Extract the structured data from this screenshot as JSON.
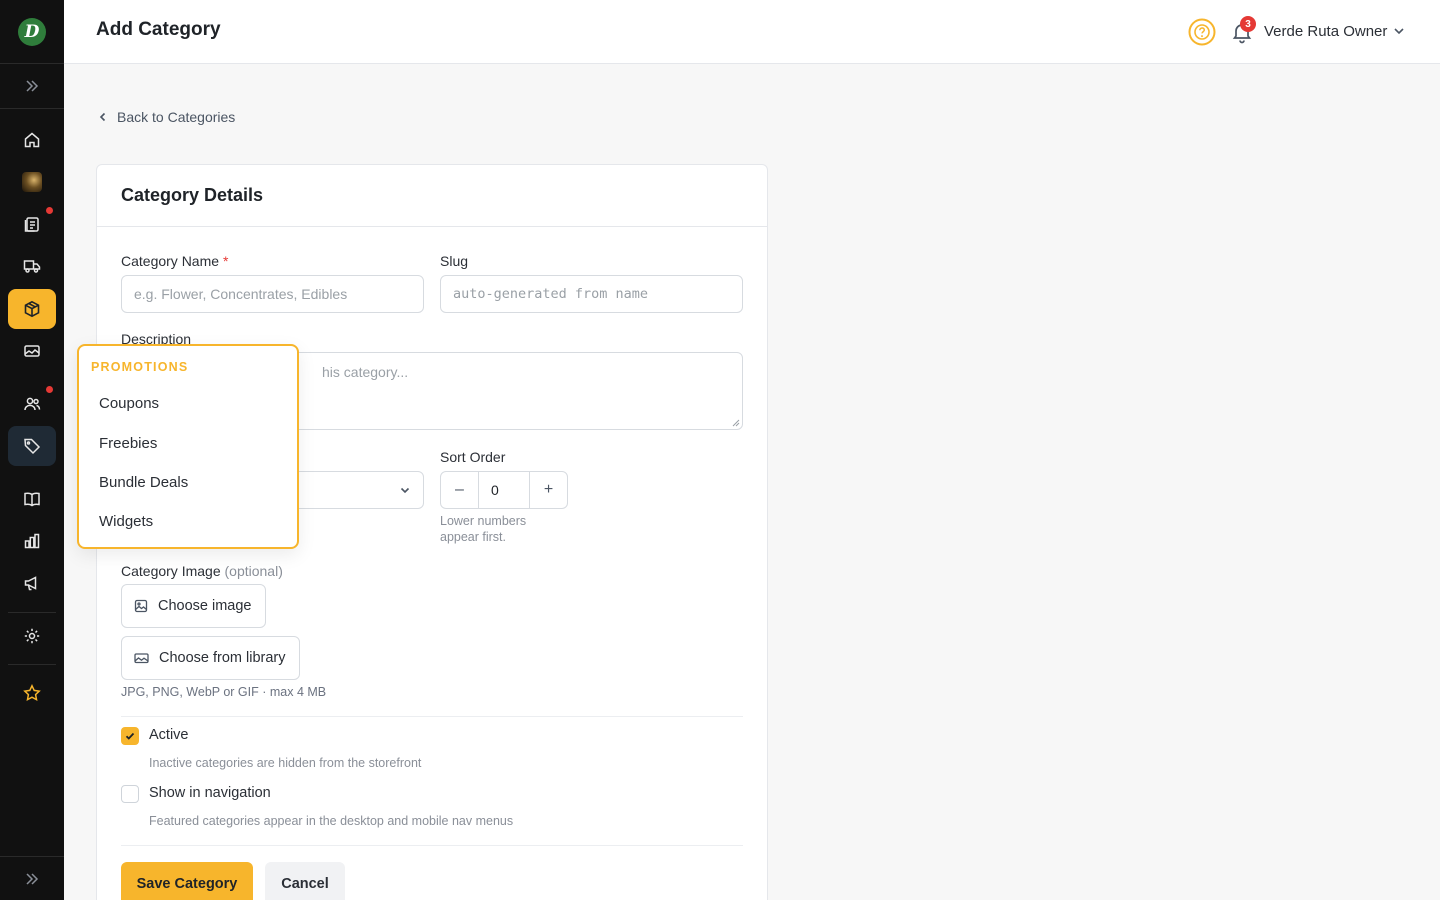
{
  "app": {
    "title": "Add Category"
  },
  "user": {
    "name": "Verde Ruta Owner",
    "notifications": "3"
  },
  "sidebar": {
    "items": [
      {
        "icon": "home-icon"
      },
      {
        "icon": "store-avatar"
      },
      {
        "icon": "orders-icon"
      },
      {
        "icon": "delivery-truck-icon"
      },
      {
        "icon": "box-icon"
      },
      {
        "icon": "media-icon"
      },
      {
        "icon": "customers-icon"
      },
      {
        "icon": "tag-icon"
      },
      {
        "icon": "catalog-icon"
      },
      {
        "icon": "analytics-icon"
      },
      {
        "icon": "megaphone-icon"
      },
      {
        "icon": "settings-icon"
      },
      {
        "icon": "star-icon"
      }
    ]
  },
  "nav": {
    "back": "Back to Categories"
  },
  "card": {
    "title": "Category Details"
  },
  "form": {
    "name": {
      "label": "Category Name",
      "required": "*",
      "placeholder": "e.g. Flower, Concentrates, Edibles"
    },
    "slug": {
      "label": "Slug",
      "placeholder": "auto-generated from name"
    },
    "description": {
      "label": "Description",
      "placeholder_visible": "his category..."
    },
    "sort": {
      "label": "Sort Order",
      "value": "0",
      "minus": "–",
      "plus": "+",
      "help_line1": "Lower numbers",
      "help_line2": "appear first."
    },
    "image": {
      "label": "Category Image",
      "optional": "(optional)",
      "choose": "Choose image",
      "library": "Choose from library",
      "help": "JPG, PNG, WebP or GIF · max 4 MB"
    },
    "active": {
      "label": "Active",
      "checked": true,
      "help": "Inactive categories are hidden from the storefront"
    },
    "show_nav": {
      "label": "Show in navigation",
      "checked": false,
      "help": "Featured categories appear in the desktop and mobile nav menus"
    },
    "save": "Save Category",
    "cancel": "Cancel"
  },
  "popover": {
    "heading": "PROMOTIONS",
    "items": [
      "Coupons",
      "Freebies",
      "Bundle Deals",
      "Widgets"
    ]
  },
  "colors": {
    "accent": "#f7b52c",
    "sidebar": "#111111",
    "danger": "#e53935"
  }
}
